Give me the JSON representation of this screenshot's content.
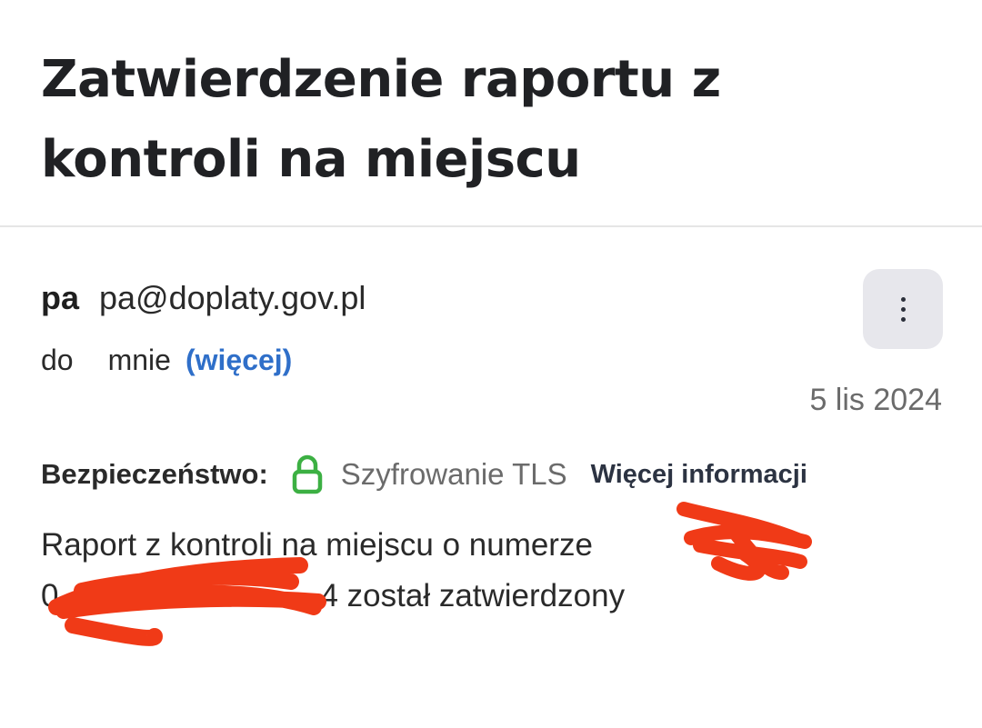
{
  "email": {
    "subject": "Zatwierdzenie raportu z kontroli na miejscu",
    "sender": {
      "name": "pa",
      "email": "pa@doplaty.gov.pl"
    },
    "recipient": {
      "label": "do",
      "name": "mnie",
      "more_label": "(więcej)"
    },
    "date": "5 lis 2024",
    "security": {
      "label": "Bezpieczeństwo:",
      "encryption": "Szyfrowanie TLS",
      "more_info": "Więcej informacji",
      "lock_icon": "lock-icon",
      "lock_color": "#3cb043"
    },
    "body": {
      "line1": "Raport z kontroli na miejscu o numerze",
      "line2_prefix": "0",
      "line2_suffix": "4 został zatwierdzony"
    },
    "redaction_color": "#f03a17"
  },
  "menu": {
    "icon": "more-vertical-icon"
  }
}
